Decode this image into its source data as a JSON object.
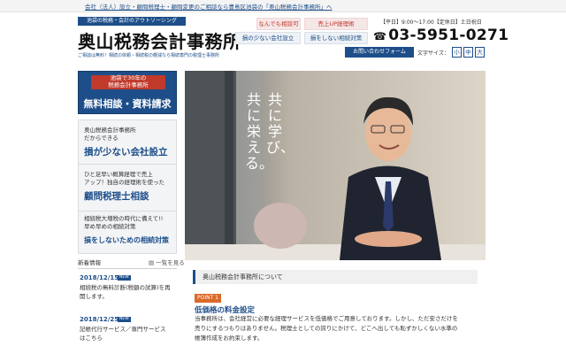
{
  "topbar": {
    "text": "会社（法人）設立・顧問税理士・顧問変更のご相談なら豊島区池袋の「奥山税務会計事務所」へ"
  },
  "header": {
    "tagline": "池袋の税務・会計のアウトソーシング",
    "logo": "奥山税務会計事務所",
    "subcopy": "ご相談は無料！相続の依頼・相続税の軽減なら相続専門の税理士事務所",
    "tags": [
      "なんでも相談可",
      "売上UP経理術",
      "損の少ない会社設立",
      "損をしない相続対策"
    ],
    "hours": "【平日】9:00〜17:00【定休日】土日祝日",
    "phone": "03-5951-0271",
    "contact_button": "お問い合わせフォーム",
    "font_size_label": "文字サイズ：",
    "font_sizes": [
      "小",
      "中",
      "大"
    ]
  },
  "sidebar": {
    "banner_ribbon_line1": "池袋で30年の",
    "banner_ribbon_line2": "税務会計事務所",
    "banner_main": "無料相談・資料請求",
    "card1_small1": "奥山税務会計事務所",
    "card1_small2": "だからできる",
    "card1_big": "損が少ない会社設立",
    "card2_small1": "ひと足早い概算経理で売上",
    "card2_small2": "アップ！独自の経理術を使った",
    "card2_big": "顧問税理士相談",
    "card3_small1": "相続税大増税の時代に備えて!!",
    "card3_small2": "早め早めの相続対策",
    "card3_big": "損をしないための相続対策"
  },
  "news": {
    "title": "新着情報",
    "more": "一覧を見る",
    "items": [
      {
        "date": "2018/12/15",
        "badge": "NEW",
        "line1": "相続税の無料診断(税額の試算)を再",
        "line2": "開します。"
      },
      {
        "date": "2018/12/25",
        "badge": "NEW",
        "line1": "記帳代行サービス／専門サービス",
        "line2": "はこちら"
      }
    ]
  },
  "hero": {
    "copy_col1": "共に学び、",
    "copy_col2": "共に栄える。"
  },
  "main": {
    "section_title": "奥山税務会計事務所について",
    "point_label": "POINT 1",
    "point_title": "低価格の料金設定",
    "body_line1": "当事務所は、会社経営に必要な経理サービスを低価格でご用意しております。しかし、ただ安さだけを",
    "body_line2": "売りにするつもりはありません。税理士としての誇りにかけて、どこへ出しても恥ずかしくない水準の",
    "body_line3": "帳簿作成をお約束します。"
  },
  "colors": {
    "navy": "#1d4e89",
    "red": "#c0392b",
    "orange": "#d96a2b"
  }
}
